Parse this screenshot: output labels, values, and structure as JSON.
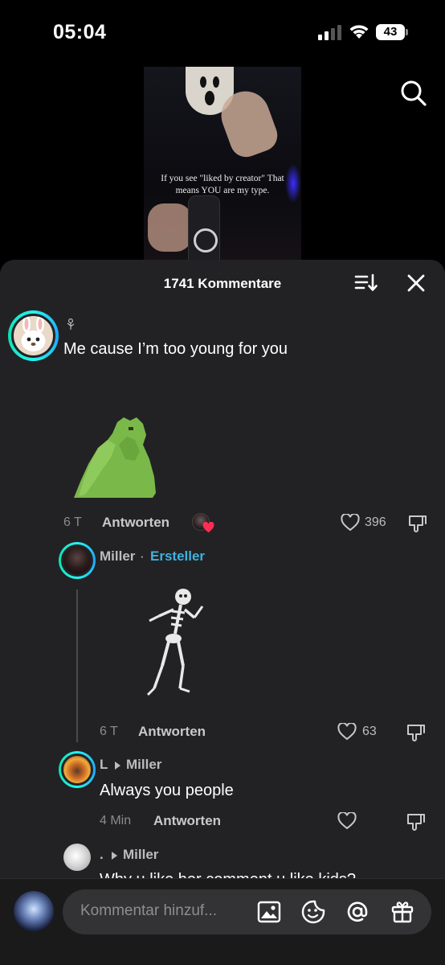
{
  "status_bar": {
    "time": "05:04",
    "battery": "43"
  },
  "video": {
    "caption": "If you see \"liked by creator\" That means YOU are my type."
  },
  "comments_sheet": {
    "title": "1741 Kommentare",
    "comments": [
      {
        "username": "",
        "text": "Me cause I’m too young for you",
        "time": "6 T",
        "reply_label": "Antworten",
        "likes": "396",
        "liked_by_creator": true
      }
    ],
    "replies": [
      {
        "username": "Miller",
        "separator": "·",
        "badge": "Ersteller",
        "time": "6 T",
        "reply_label": "Antworten",
        "likes": "63"
      },
      {
        "username": "L",
        "reply_to": "Miller",
        "text": "Always you people",
        "time": "4 Min",
        "reply_label": "Antworten",
        "likes": ""
      },
      {
        "username": ".",
        "reply_to": "Miller",
        "text": "Why u like her comment u like kids?"
      }
    ]
  },
  "composer": {
    "placeholder": "Kommentar hinzuf..."
  },
  "icons": {
    "search": "search-icon",
    "sort": "sort-icon",
    "close": "close-icon",
    "heart": "heart-icon",
    "dislike": "dislike-icon",
    "image": "image-icon",
    "sticker": "sticker-icon",
    "mention": "at-icon",
    "gift": "gift-icon"
  },
  "colors": {
    "sheet_bg": "#222224",
    "creator_accent": "#3fb2e0",
    "like_red": "#fe2c55"
  }
}
